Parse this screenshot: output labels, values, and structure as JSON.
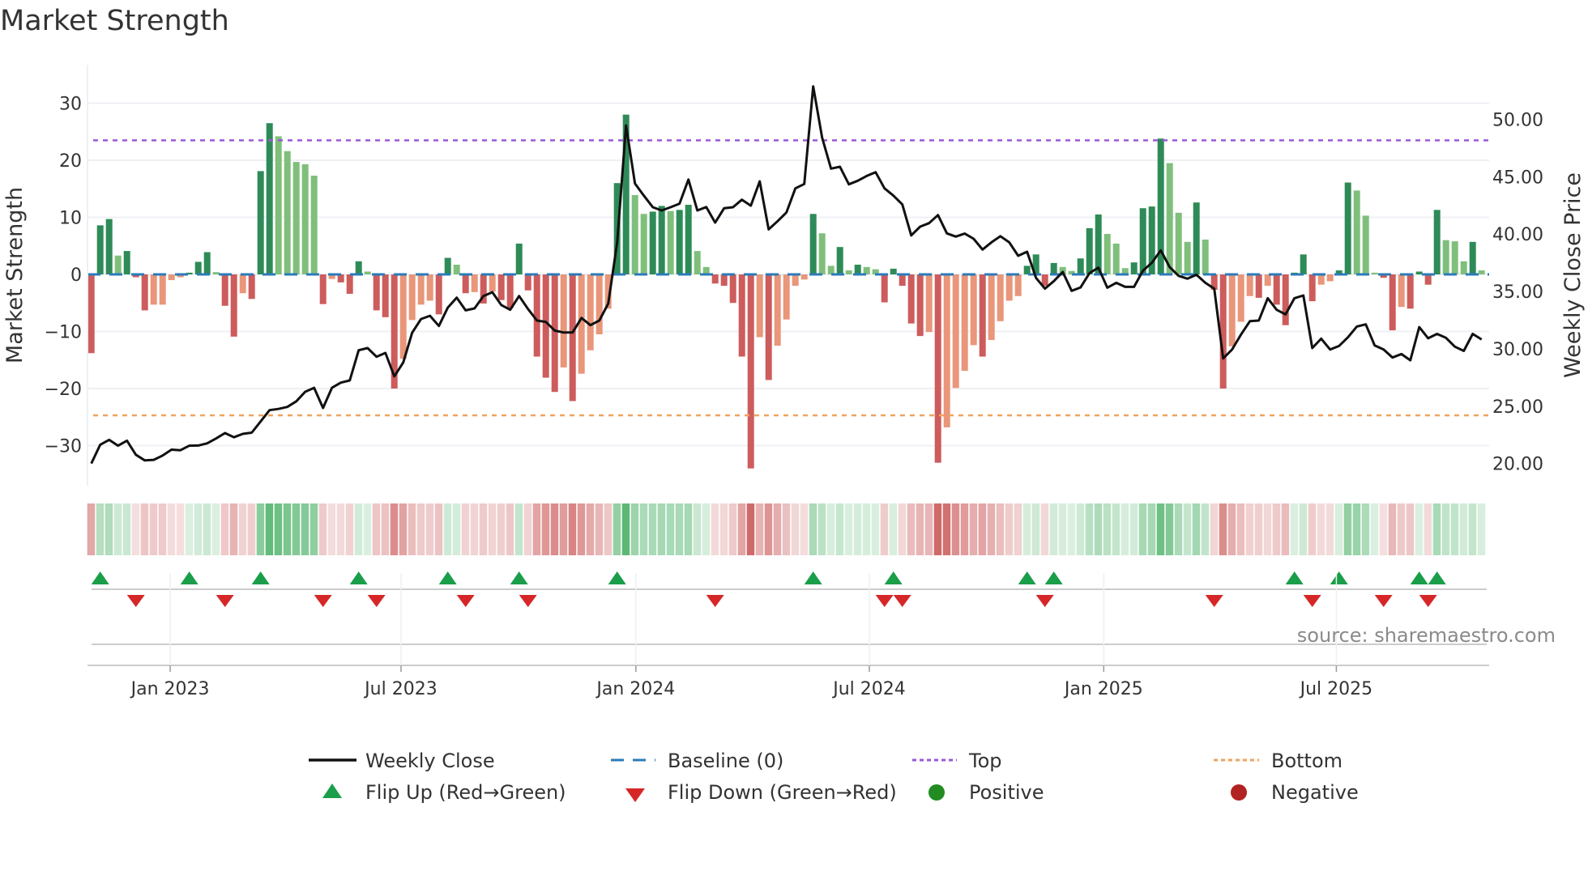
{
  "title": "Market Strength",
  "chart_data": {
    "type": "bar",
    "title": "Market Strength",
    "ylabel": "Market Strength",
    "y2label": "Weekly Close Price",
    "ylim": [
      -37,
      37.5
    ],
    "y2lim": [
      17.5,
      55.5
    ],
    "yticks": [
      {
        "v": 30,
        "label": "30"
      },
      {
        "v": 20,
        "label": "20"
      },
      {
        "v": 10,
        "label": "10"
      },
      {
        "v": 0,
        "label": "0"
      },
      {
        "v": -10,
        "label": "−10"
      },
      {
        "v": -20,
        "label": "−20"
      },
      {
        "v": -30,
        "label": "−30"
      }
    ],
    "y2ticks": [
      {
        "v": 50,
        "label": "50.00"
      },
      {
        "v": 45,
        "label": "45.00"
      },
      {
        "v": 40,
        "label": "40.00"
      },
      {
        "v": 35,
        "label": "35.00"
      },
      {
        "v": 30,
        "label": "30.00"
      },
      {
        "v": 25,
        "label": "25.00"
      },
      {
        "v": 20,
        "label": "20.00"
      }
    ],
    "xticks": [
      {
        "week": 8.85,
        "label": "Jan 2023"
      },
      {
        "week": 34.75,
        "label": "Jul 2023"
      },
      {
        "week": 61.1,
        "label": "Jan 2024"
      },
      {
        "week": 87.3,
        "label": "Jul 2024"
      },
      {
        "week": 113.6,
        "label": "Jan 2025"
      },
      {
        "week": 139.7,
        "label": "Jul 2025"
      }
    ],
    "top_level": 23.5,
    "bottom_level": -24.7,
    "baseline": 0,
    "strength": [
      -13.8,
      8.6,
      9.7,
      3.3,
      4.1,
      -0.5,
      -6.3,
      -5.3,
      -5.3,
      -1,
      -0.5,
      0.3,
      2.2,
      3.9,
      0.4,
      -5.5,
      -10.9,
      -3.3,
      -4.3,
      18.1,
      26.5,
      24.2,
      21.6,
      19.7,
      19.3,
      17.3,
      -5.2,
      -0.8,
      -1.4,
      -3.4,
      2.3,
      0.5,
      -6.3,
      -7.5,
      -20,
      -14.8,
      -8,
      -5.3,
      -4.6,
      -7,
      2.9,
      1.7,
      -3.3,
      -3.1,
      -5.1,
      -3,
      -4.5,
      -5.9,
      5.4,
      -2.8,
      -14.4,
      -18.1,
      -20.6,
      -16.3,
      -22.2,
      -17.4,
      -13.3,
      -10.5,
      -6,
      16,
      28,
      13.9,
      10.6,
      11,
      12,
      11.1,
      11.3,
      12.2,
      4.1,
      1.3,
      -1.6,
      -2,
      -5,
      -14.4,
      -34,
      -11,
      -18.5,
      -12.5,
      -7.9,
      -2,
      -0.9,
      10.6,
      7.2,
      1.5,
      4.8,
      0.7,
      1.7,
      1.3,
      0.9,
      -4.9,
      1,
      -2,
      -8.6,
      -10.8,
      -10.1,
      -33,
      -26.8,
      -19.9,
      -16.9,
      -12.4,
      -14.4,
      -11.5,
      -8.2,
      -4.6,
      -3.8,
      1.5,
      3.5,
      -2,
      2,
      1.3,
      0.6,
      2.8,
      8.1,
      10.5,
      7.1,
      5.4,
      1.1,
      2.1,
      11.6,
      11.9,
      23.8,
      19.5,
      10.8,
      5.7,
      12.6,
      6.1,
      -2.7,
      -20,
      -12.6,
      -8.3,
      -3.8,
      -4.1,
      -2,
      -5.3,
      -8.9,
      0.3,
      3.5,
      -4.7,
      -1.8,
      -1.2,
      0.7,
      16.1,
      14.7,
      10.3,
      0.3,
      -0.6,
      -9.8,
      -5.7,
      -6,
      0.5,
      -1.8,
      11.3,
      6,
      5.8,
      2.3,
      5.7,
      0.7
    ],
    "weekly_close": [
      20.0,
      21.64,
      22.06,
      21.55,
      21.99,
      20.76,
      20.27,
      20.32,
      20.69,
      21.21,
      21.16,
      21.55,
      21.57,
      21.76,
      22.18,
      22.65,
      22.29,
      22.58,
      22.69,
      23.66,
      24.65,
      24.76,
      24.93,
      25.42,
      26.25,
      26.6,
      24.84,
      26.6,
      27.05,
      27.24,
      29.87,
      30.06,
      29.31,
      29.64,
      27.59,
      28.81,
      31.4,
      32.6,
      32.88,
      31.99,
      33.59,
      34.46,
      33.35,
      33.52,
      34.6,
      34.93,
      33.82,
      33.4,
      34.6,
      33.47,
      32.46,
      32.34,
      31.59,
      31.42,
      31.42,
      32.69,
      32.06,
      32.46,
      33.94,
      39.24,
      49.47,
      44.41,
      43.35,
      42.34,
      42.06,
      42.34,
      42.65,
      44.76,
      42.06,
      42.36,
      41.0,
      42.25,
      42.34,
      43.0,
      42.48,
      44.6,
      40.41,
      41.12,
      41.89,
      43.99,
      44.37,
      52.88,
      48.41,
      45.71,
      45.87,
      44.34,
      44.65,
      45.07,
      45.4,
      43.99,
      43.35,
      42.58,
      39.89,
      40.65,
      40.95,
      41.66,
      40.06,
      39.78,
      40.04,
      39.59,
      38.65,
      39.28,
      39.82,
      39.28,
      38.11,
      38.46,
      36.18,
      35.24,
      35.9,
      36.7,
      35.05,
      35.35,
      36.6,
      37.07,
      35.33,
      35.75,
      35.4,
      35.4,
      36.81,
      37.5,
      38.58,
      37.12,
      36.36,
      36.11,
      36.46,
      35.75,
      35.24,
      29.16,
      29.94,
      31.24,
      32.41,
      32.46,
      34.41,
      33.4,
      33.0,
      34.41,
      34.65,
      30.06,
      30.88,
      29.94,
      30.25,
      31.0,
      31.94,
      32.13,
      30.29,
      29.94,
      29.24,
      29.54,
      29.0,
      31.89,
      30.92,
      31.3,
      30.95,
      30.18,
      29.82,
      31.3,
      30.81
    ],
    "colors": {
      "positive_rising": "#2e8b57",
      "positive_falling": "#7fbf7b",
      "negative_falling": "#cd5c5c",
      "negative_rising": "#e9967a",
      "price": "#111111",
      "baseline": "#2b7bb9",
      "top": "#9b59d6",
      "bottom": "#f0a35e",
      "flip_up": "#1a9e4a",
      "flip_down": "#d62728",
      "positive": "#228b22",
      "negative": "#b22222"
    },
    "legend": {
      "placement": "bottom",
      "items": [
        "Weekly Close",
        "Baseline (0)",
        "Top",
        "Bottom",
        "Flip Up (Red→Green)",
        "Flip Down (Green→Red)",
        "Positive",
        "Negative"
      ]
    }
  },
  "source": "source: sharemaestro.com"
}
